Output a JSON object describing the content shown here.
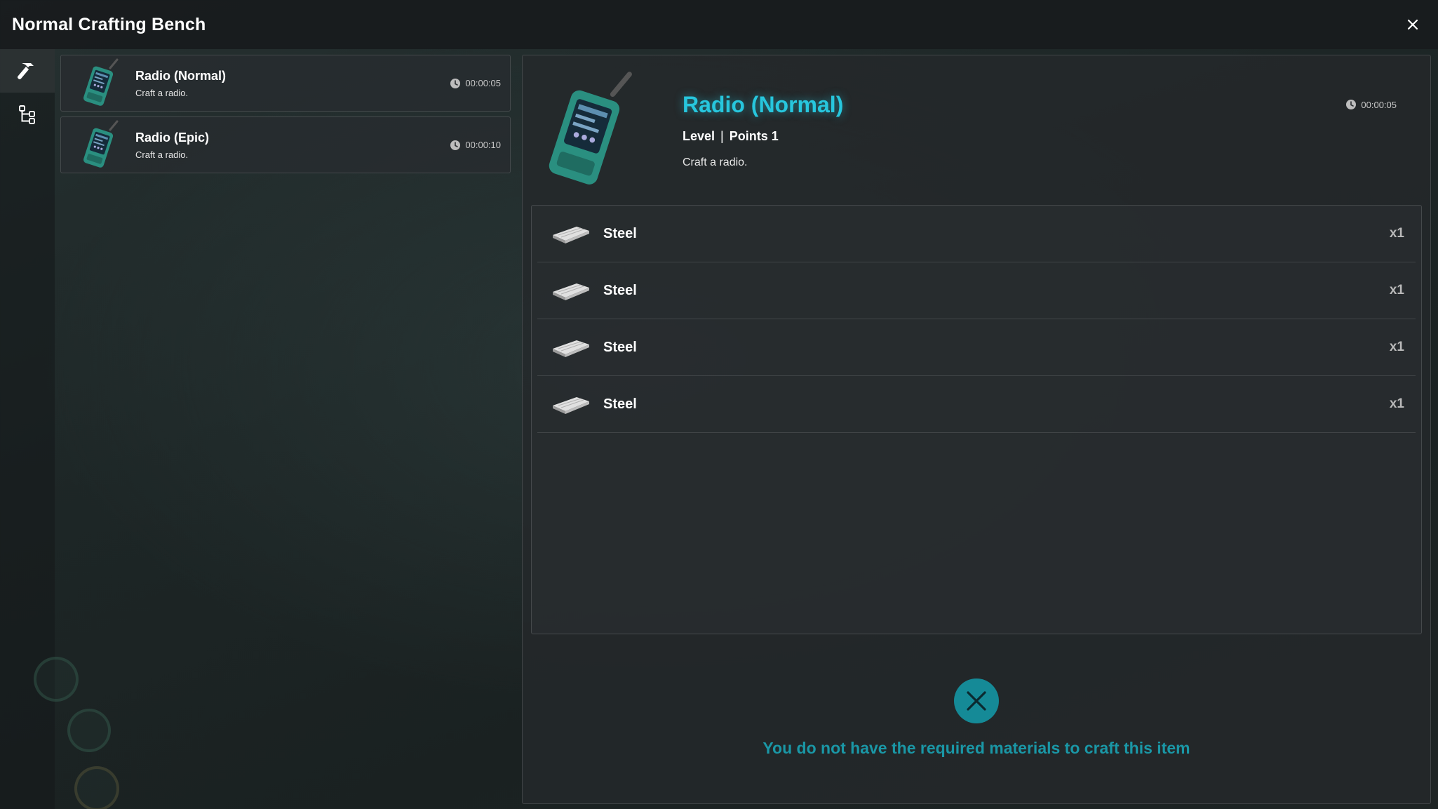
{
  "window": {
    "title": "Normal Crafting Bench",
    "close_icon": "close-icon"
  },
  "rail": {
    "items": [
      {
        "icon": "hammer-icon",
        "active": true
      },
      {
        "icon": "tree-icon",
        "active": false
      }
    ]
  },
  "recipes": [
    {
      "name": "Radio (Normal)",
      "description": "Craft a radio.",
      "time": "00:00:05",
      "icon": "radio-icon"
    },
    {
      "name": "Radio (Epic)",
      "description": "Craft a radio.",
      "time": "00:00:10",
      "icon": "radio-icon"
    }
  ],
  "selected": {
    "name": "Radio (Normal)",
    "level_label": "Level",
    "points_label": "Points 1",
    "description": "Craft a radio.",
    "time": "00:00:05"
  },
  "materials": [
    {
      "name": "Steel",
      "qty": "x1",
      "icon": "steel-icon"
    },
    {
      "name": "Steel",
      "qty": "x1",
      "icon": "steel-icon"
    },
    {
      "name": "Steel",
      "qty": "x1",
      "icon": "steel-icon"
    },
    {
      "name": "Steel",
      "qty": "x1",
      "icon": "steel-icon"
    }
  ],
  "status": {
    "message": "You do not have the required materials to craft this item",
    "icon": "x-circle-icon"
  },
  "colors": {
    "accent": "#27c6dd",
    "status": "#1a97a6",
    "status_icon_bg": "#158a97"
  }
}
